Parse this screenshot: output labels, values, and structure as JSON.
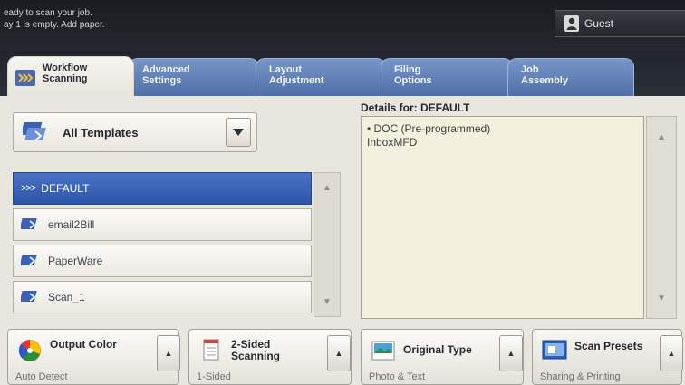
{
  "status": {
    "line1": "eady to scan your job.",
    "line2": "ay 1 is empty.  Add paper."
  },
  "user": {
    "label": "Guest"
  },
  "tabs": [
    {
      "label": "Workflow\nScanning",
      "active": true
    },
    {
      "label": "Advanced\nSettings"
    },
    {
      "label": "Layout\nAdjustment"
    },
    {
      "label": "Filing\nOptions"
    },
    {
      "label": "Job\nAssembly"
    }
  ],
  "templates": {
    "selector_label": "All Templates",
    "items": [
      "DEFAULT",
      "email2Bill",
      "PaperWare",
      "Scan_1"
    ],
    "selected_prefix": ">>>"
  },
  "details": {
    "title": "Details for: DEFAULT",
    "line1": "• DOC (Pre-programmed)",
    "line2": "InboxMFD"
  },
  "features": {
    "output_color": {
      "title": "Output Color",
      "value": "Auto Detect"
    },
    "two_sided": {
      "title": "2-Sided\nScanning",
      "value": "1-Sided"
    },
    "original_type": {
      "title": "Original Type",
      "value": "Photo & Text"
    },
    "scan_presets": {
      "title": "Scan Presets",
      "value": "Sharing & Printing"
    }
  },
  "colors": {
    "tab_blue": "#5d7fb8",
    "selected_row": "#2d56a8",
    "panel": "#e8e6df"
  }
}
